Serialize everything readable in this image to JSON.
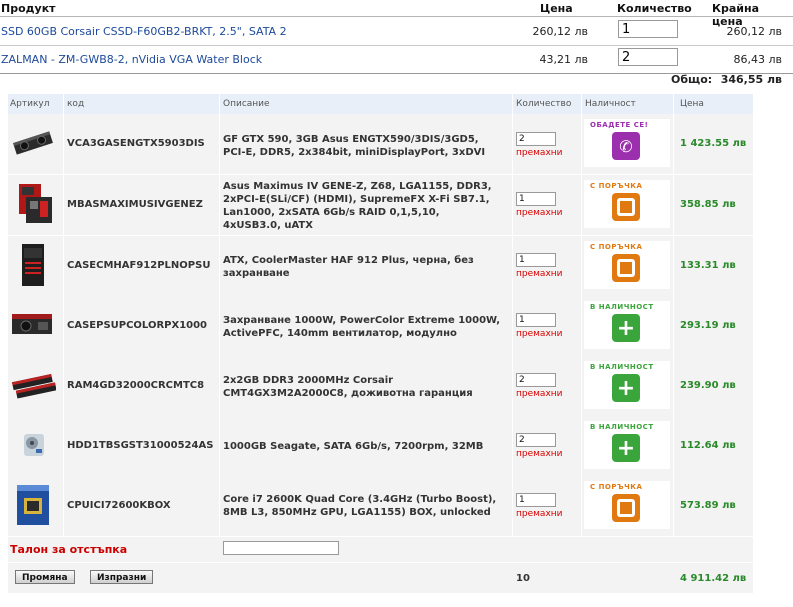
{
  "cart": {
    "headers": {
      "product": "Продукт",
      "price": "Цена",
      "quantity": "Количество",
      "final_price": "Крайна цена"
    },
    "items": [
      {
        "name": "SSD 60GB Corsair CSSD-F60GB2-BRKT, 2.5\", SATA 2",
        "price": "260,12 лв",
        "quantity": "1",
        "final_price": "260,12 лв"
      },
      {
        "name": "ZALMAN - ZM-GWB8-2, nVidia VGA Water Block",
        "price": "43,21 лв",
        "quantity": "2",
        "final_price": "86,43 лв"
      }
    ],
    "total_label": "Общо:",
    "total_value": "346,55 лв"
  },
  "products": {
    "headers": {
      "article": "Артикул",
      "code": "код",
      "description": "Описание",
      "quantity": "Количество",
      "availability": "Наличност",
      "price": "Цена"
    },
    "remove_label": "премахни",
    "rows": [
      {
        "code": "VCA3GASENGTX5903DIS",
        "desc_lines": [
          "GF GTX 590, 3GB Asus ENGTX590/3DIS/3GD5,",
          "PCI-E, DDR5, 2x384bit, miniDisplayPort, 3xDVI"
        ],
        "qty": "2",
        "availability": "ОБАДЕТЕ СЕ!",
        "avail_type": "call",
        "avail_color": "#9b2fae",
        "avail_icon": "phone-icon",
        "price": "1 423.55 лв"
      },
      {
        "code": "MBASMAXIMUSIVGENEZ",
        "desc_lines": [
          "Asus Maximus IV GENE-Z, Z68, LGA1155, DDR3,",
          "2xPCI-E(SLi/CF) (HDMI), SupremeFX X-Fi SB7.1,",
          "Lan1000, 2xSATA 6Gb/s RAID 0,1,5,10,",
          "4xUSB3.0, uATX"
        ],
        "qty": "1",
        "availability": "С ПОРЪЧКА",
        "avail_type": "order",
        "avail_color": "#e07a10",
        "avail_icon": "order-icon",
        "price": "358.85 лв"
      },
      {
        "code": "CASECMHAF912PLNOPSU",
        "desc_lines": [
          "ATX, CoolerMaster HAF 912 Plus, черна, без",
          "захранване"
        ],
        "qty": "1",
        "availability": "С ПОРЪЧКА",
        "avail_type": "order",
        "avail_color": "#e07a10",
        "avail_icon": "order-icon",
        "price": "133.31 лв"
      },
      {
        "code": "CASEPSUPCOLORPX1000",
        "desc_lines": [
          "Захранване 1000W, PowerColor Extreme 1000W,",
          "ActivePFC, 140mm вентилатор, модулно"
        ],
        "qty": "1",
        "availability": "В НАЛИЧНОСТ",
        "avail_type": "stock",
        "avail_color": "#3aa53a",
        "avail_icon": "plus-icon",
        "price": "293.19 лв"
      },
      {
        "code": "RAM4GD32000CRCMTC8",
        "desc_lines": [
          "2x2GB DDR3 2000MHz Corsair",
          "CMT4GX3M2A2000C8, доживотна гаранция"
        ],
        "qty": "2",
        "availability": "В НАЛИЧНОСТ",
        "avail_type": "stock",
        "avail_color": "#3aa53a",
        "avail_icon": "plus-icon",
        "price": "239.90 лв"
      },
      {
        "code": "HDD1TBSGST31000524AS",
        "desc_lines": [
          "1000GB Seagate, SATA 6Gb/s, 7200rpm, 32MB"
        ],
        "qty": "2",
        "availability": "В НАЛИЧНОСТ",
        "avail_type": "stock",
        "avail_color": "#3aa53a",
        "avail_icon": "plus-icon",
        "price": "112.64 лв"
      },
      {
        "code": "CPUICI72600KBOX",
        "desc_lines": [
          "Core i7 2600K Quad Core (3.4GHz (Turbo Boost),",
          "8MB L3, 850MHz GPU, LGA1155) BOX, unlocked"
        ],
        "qty": "1",
        "availability": "С ПОРЪЧКА",
        "avail_type": "order",
        "avail_color": "#e07a10",
        "avail_icon": "order-icon",
        "price": "573.89 лв"
      }
    ],
    "coupon_label": "Талон за отстъпка",
    "coupon_value": "",
    "update_button": "Промяна",
    "clear_button": "Изпразни",
    "total_qty": "10",
    "total_price": "4 911.42 лв"
  },
  "colors": {
    "link": "#1d4a9a",
    "remove": "#dd0000",
    "price_green": "#2a8a2a",
    "coupon_red": "#cc0000",
    "header_bg": "#e8eff8"
  }
}
